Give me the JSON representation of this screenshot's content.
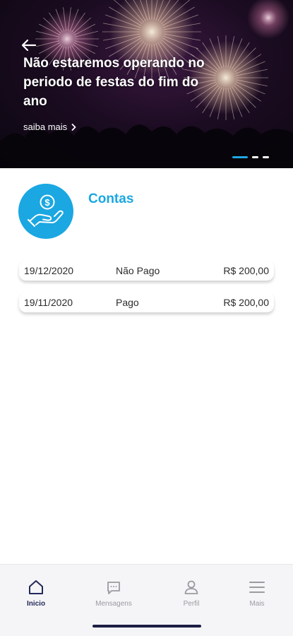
{
  "banner": {
    "title": "Não estaremos operando no periodo de festas do fim do ano",
    "link_label": "saiba mais",
    "slides_count": 3,
    "active_slide": 1
  },
  "section": {
    "title": "Contas",
    "icon": "hand-coin-icon"
  },
  "bills": [
    {
      "date": "19/12/2020",
      "status": "Não Pago",
      "amount": "R$ 200,00"
    },
    {
      "date": "19/11/2020",
      "status": "Pago",
      "amount": "R$ 200,00"
    }
  ],
  "nav": {
    "items": [
      {
        "label": "Inicio",
        "icon": "home-icon",
        "active": true
      },
      {
        "label": "Mensagens",
        "icon": "message-icon",
        "active": false
      },
      {
        "label": "Perfil",
        "icon": "user-icon",
        "active": false
      },
      {
        "label": "Mais",
        "icon": "menu-icon",
        "active": false
      }
    ]
  },
  "colors": {
    "accent": "#1aa7e2",
    "nav_active": "#23285a",
    "nav_inactive": "#9a9aa2"
  }
}
